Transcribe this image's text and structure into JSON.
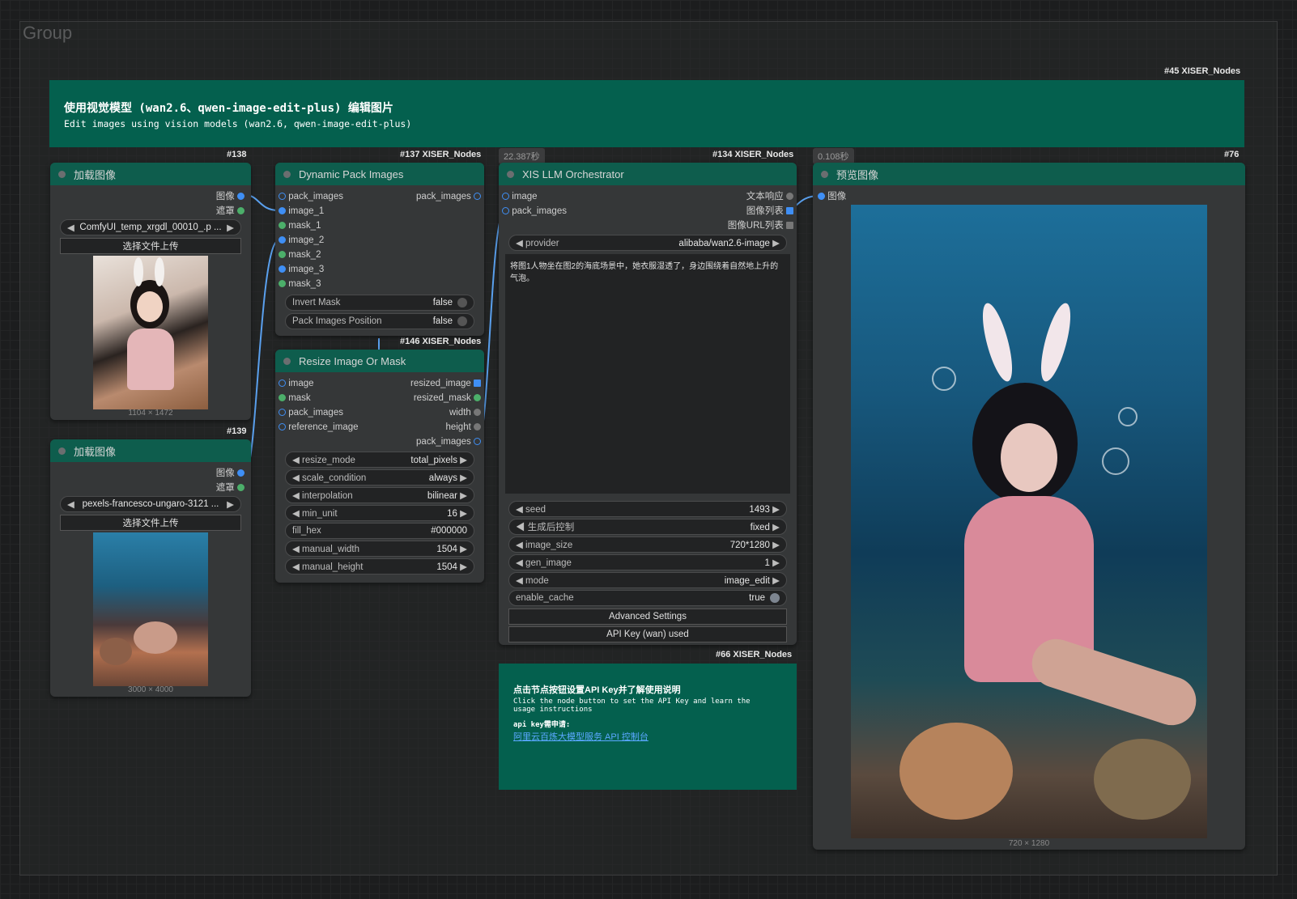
{
  "group_title": "Group",
  "header_note": {
    "tag": "#45 XISER_Nodes",
    "title": "使用视觉模型 (wan2.6、qwen-image-edit-plus) 编辑图片",
    "subtitle": "Edit images using vision models (wan2.6, qwen-image-edit-plus)"
  },
  "load1": {
    "id": "#138",
    "title": "加载图像",
    "out_image": "图像",
    "out_mask": "遮罩",
    "file": "ComfyUI_temp_xrgdl_00010_.p ...",
    "upload": "选择文件上传",
    "dims": "1104 × 1472"
  },
  "load2": {
    "id": "#139",
    "title": "加载图像",
    "out_image": "图像",
    "out_mask": "遮罩",
    "file": "pexels-francesco-ungaro-3121 ...",
    "upload": "选择文件上传",
    "dims": "3000 × 4000"
  },
  "pack": {
    "id": "#137 XISER_Nodes",
    "title": "Dynamic Pack Images",
    "inputs": [
      "pack_images",
      "image_1",
      "mask_1",
      "image_2",
      "mask_2",
      "image_3",
      "mask_3"
    ],
    "output": "pack_images",
    "invert_mask": {
      "label": "Invert Mask",
      "value": "false"
    },
    "pack_pos": {
      "label": "Pack Images Position",
      "value": "false"
    }
  },
  "resize": {
    "id": "#146 XISER_Nodes",
    "title": "Resize Image Or Mask",
    "inputs": [
      "image",
      "mask",
      "pack_images",
      "reference_image"
    ],
    "outputs": [
      "resized_image",
      "resized_mask",
      "width",
      "height",
      "pack_images"
    ],
    "widgets": [
      {
        "label": "resize_mode",
        "value": "total_pixels"
      },
      {
        "label": "scale_condition",
        "value": "always"
      },
      {
        "label": "interpolation",
        "value": "bilinear"
      },
      {
        "label": "min_unit",
        "value": "16"
      },
      {
        "label": "fill_hex",
        "value": "#000000"
      },
      {
        "label": "manual_width",
        "value": "1504"
      },
      {
        "label": "manual_height",
        "value": "1504"
      }
    ]
  },
  "llm": {
    "id": "#134 XISER_Nodes",
    "time": "22.387秒",
    "title": "XIS LLM Orchestrator",
    "in_image": "image",
    "in_pack": "pack_images",
    "out_text": "文本响应",
    "out_list": "图像列表",
    "out_url": "图像URL列表",
    "provider": {
      "label": "provider",
      "value": "alibaba/wan2.6-image"
    },
    "prompt": "将图1人物坐在图2的海底场景中，她衣服湿透了，身边围绕着自然地上升的气泡。",
    "widgets": [
      {
        "label": "seed",
        "value": "1493"
      },
      {
        "label": "生成后控制",
        "value": "fixed"
      },
      {
        "label": "image_size",
        "value": "720*1280"
      },
      {
        "label": "gen_image",
        "value": "1"
      },
      {
        "label": "mode",
        "value": "image_edit"
      }
    ],
    "cache": {
      "label": "enable_cache",
      "value": "true"
    },
    "advanced": "Advanced Settings",
    "apikey": "API Key (wan) used"
  },
  "info_note": {
    "tag": "#66 XISER_Nodes",
    "title": "点击节点按钮设置API Key并了解使用说明",
    "body": "Click the node button to set the API Key and learn the usage instructions",
    "api_label": "api key需申请:",
    "link": "阿里云百炼大模型服务 API 控制台"
  },
  "preview": {
    "id": "#76",
    "time": "0.108秒",
    "title": "预览图像",
    "in_image": "图像",
    "dims": "720 × 1280"
  }
}
